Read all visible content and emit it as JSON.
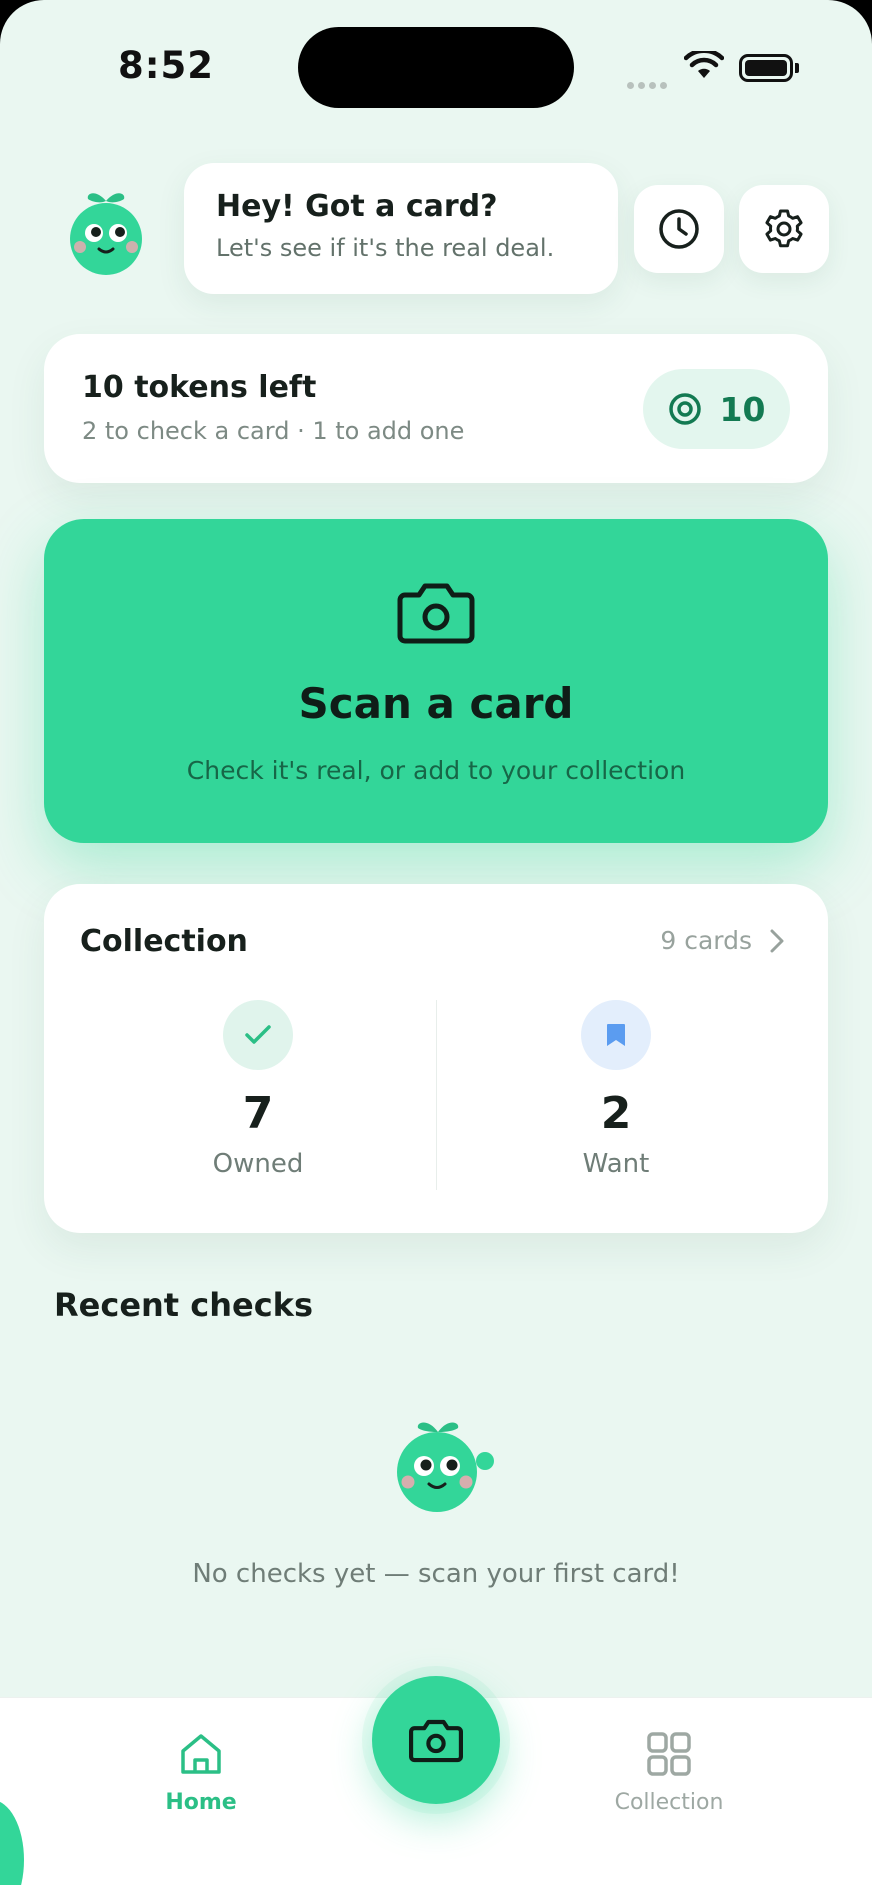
{
  "status_bar": {
    "time": "8:52"
  },
  "header": {
    "bubble_title": "Hey! Got a card?",
    "bubble_subtitle": "Let's see if it's the real deal."
  },
  "tokens": {
    "title": "10 tokens left",
    "subtitle": "2 to check a card · 1 to add one",
    "count": "10"
  },
  "scan": {
    "title": "Scan a card",
    "subtitle": "Check it's real, or add to your collection"
  },
  "collection": {
    "title": "Collection",
    "count_label": "9 cards",
    "owned": {
      "value": "7",
      "label": "Owned"
    },
    "want": {
      "value": "2",
      "label": "Want"
    }
  },
  "recent": {
    "title": "Recent checks",
    "empty_text": "No checks yet — scan your first card!"
  },
  "tabbar": {
    "home_label": "Home",
    "collection_label": "Collection"
  },
  "colors": {
    "accent": "#33D699",
    "background": "#EAF7F1",
    "owned_circle": "#E0F4EC",
    "want_circle": "#E3EEFC",
    "want_icon": "#5B9CF0"
  },
  "icons": [
    "mascot-icon",
    "clock-icon",
    "gear-icon",
    "token-icon",
    "camera-icon",
    "check-icon",
    "bookmark-icon",
    "chevron-right-icon",
    "home-icon",
    "grid-icon"
  ]
}
